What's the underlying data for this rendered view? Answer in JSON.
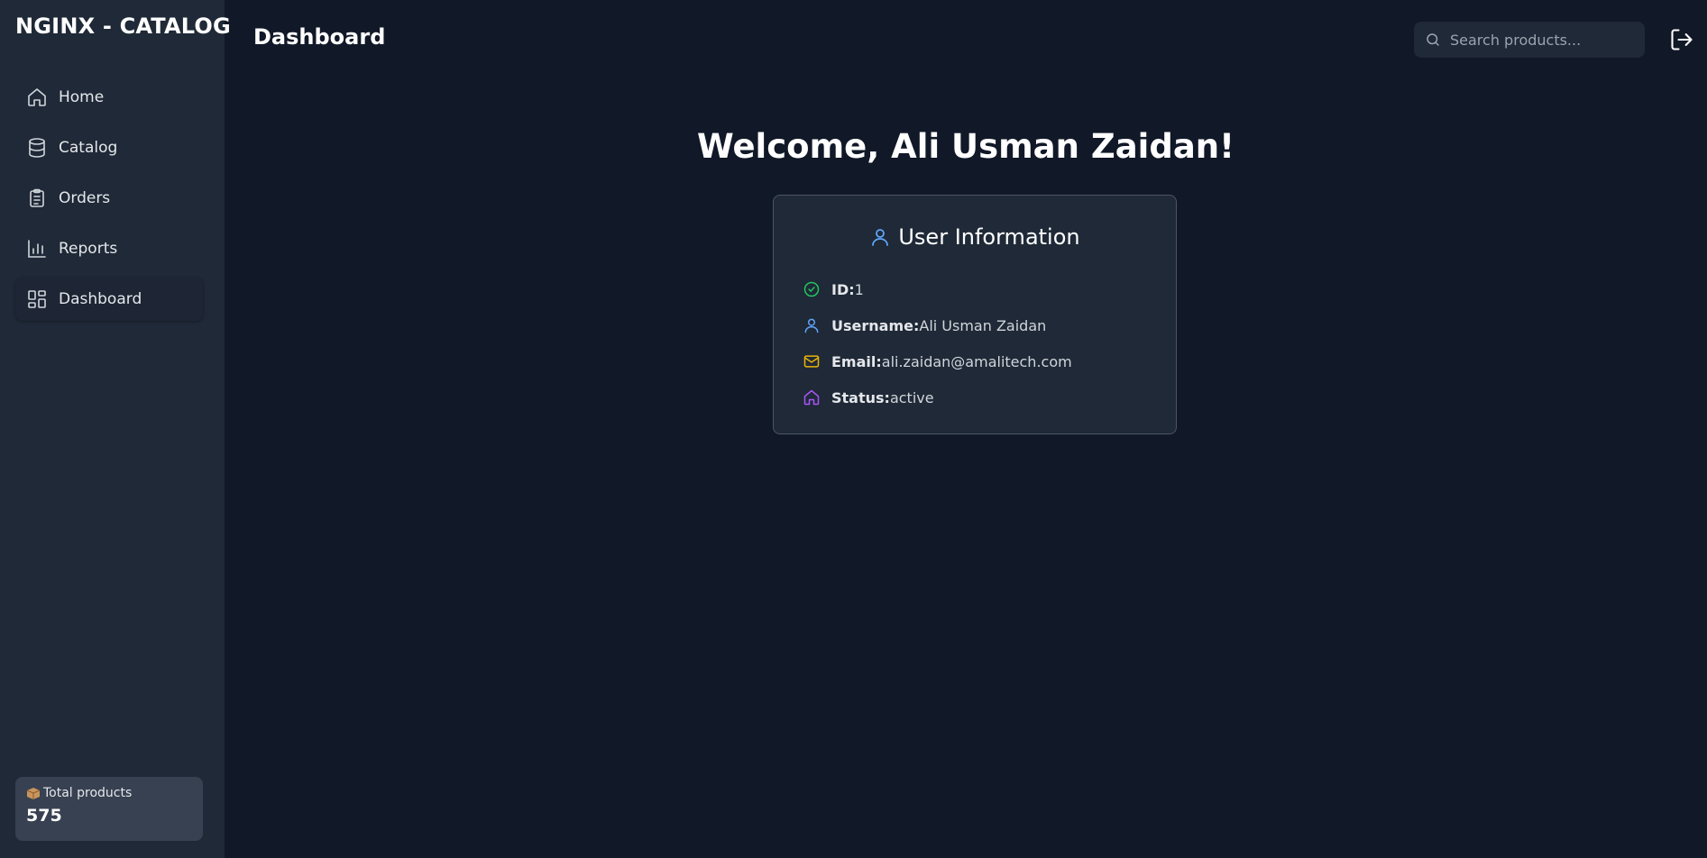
{
  "brand": "NGINX - CATALOG",
  "sidebar": {
    "items": [
      {
        "label": "Home",
        "icon": "home-icon"
      },
      {
        "label": "Catalog",
        "icon": "database-icon"
      },
      {
        "label": "Orders",
        "icon": "clipboard-icon"
      },
      {
        "label": "Reports",
        "icon": "bar-chart-icon"
      },
      {
        "label": "Dashboard",
        "icon": "layout-dashboard-icon",
        "active": true
      }
    ],
    "total": {
      "label": "Total products",
      "value": "575",
      "icon": "package-emoji"
    }
  },
  "header": {
    "title": "Dashboard",
    "search_placeholder": "Search products..."
  },
  "main": {
    "welcome": "Welcome, Ali Usman Zaidan!",
    "card": {
      "title": "User Information",
      "rows": [
        {
          "key": "ID:",
          "value": "1",
          "icon": "check-circle-icon",
          "color": "#22c55e"
        },
        {
          "key": "Username:",
          "value": "Ali Usman Zaidan",
          "icon": "user-icon",
          "color": "#60a5fa"
        },
        {
          "key": "Email:",
          "value": "ali.zaidan@amalitech.com",
          "icon": "mail-icon",
          "color": "#eab308"
        },
        {
          "key": "Status:",
          "value": "active",
          "icon": "home-icon",
          "color": "#a855f7"
        }
      ]
    }
  },
  "colors": {
    "background": "#111827",
    "sidebar": "#1f2937",
    "card": "#1f2937",
    "accent": "#60a5fa"
  }
}
